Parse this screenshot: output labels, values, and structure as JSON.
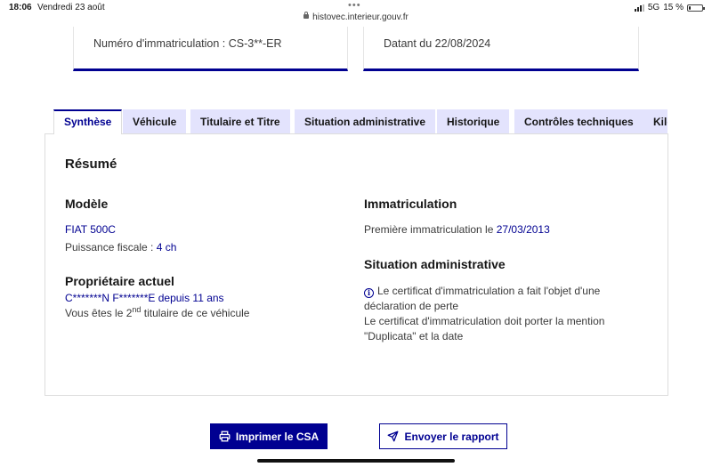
{
  "status_bar": {
    "time": "18:06",
    "date": "Vendredi 23 août",
    "url": "histovec.interieur.gouv.fr",
    "network": "5G",
    "battery": "15 %",
    "battery_level": 0.15
  },
  "cards": {
    "registration": "Numéro d'immatriculation : CS-3**-ER",
    "dated": "Datant du 22/08/2024"
  },
  "tabs": [
    {
      "label": "Synthèse",
      "active": true
    },
    {
      "label": "Véhicule",
      "active": false
    },
    {
      "label": "Titulaire et Titre",
      "active": false
    },
    {
      "label": "Situation administrative",
      "active": false
    },
    {
      "label": "Historique",
      "active": false
    },
    {
      "label": "Contrôles techniques",
      "active": false
    },
    {
      "label": "Kilo",
      "active": false
    }
  ],
  "summary": {
    "title": "Résumé",
    "model": {
      "heading": "Modèle",
      "name": "FIAT 500C",
      "fiscal_power_label": "Puissance fiscale : ",
      "fiscal_power_value": "4 ch"
    },
    "owner": {
      "heading": "Propriétaire actuel",
      "name": "C*******N F*******E",
      "since_label": " depuis ",
      "since_value": "11 ans",
      "rank_prefix": "Vous êtes le 2",
      "rank_suffix": "nd",
      "rank_rest": " titulaire de ce véhicule"
    },
    "registration": {
      "heading": "Immatriculation",
      "first_label": "Première immatriculation le ",
      "first_date": "27/03/2013"
    },
    "admin": {
      "heading": "Situation administrative",
      "line1": "Le certificat d'immatriculation a fait l'objet d'une",
      "line2": "déclaration de perte",
      "line3": "Le certificat d'immatriculation doit porter la mention",
      "line4": "\"Duplicata\" et la date"
    }
  },
  "actions": {
    "print_label": "Imprimer le CSA",
    "send_label": "Envoyer le rapport"
  },
  "colors": {
    "primary": "#000091",
    "tab_bg": "#e3e3fd",
    "text": "#161616"
  }
}
